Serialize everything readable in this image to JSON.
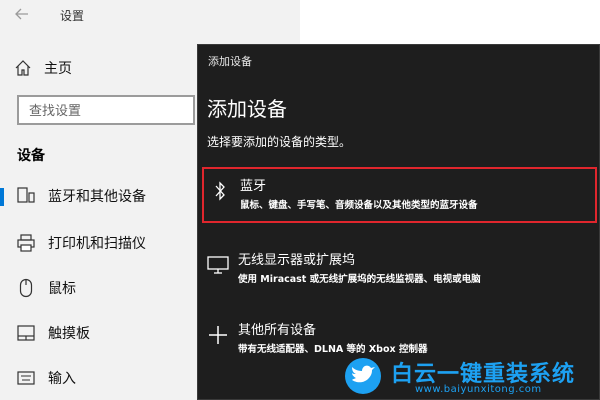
{
  "window": {
    "title": "设置"
  },
  "sidebar": {
    "home_label": "主页",
    "search_placeholder": "查找设置",
    "section_title": "设备",
    "items": [
      {
        "label": "蓝牙和其他设备",
        "icon": "bluetooth-devices-icon",
        "selected": true
      },
      {
        "label": "打印机和扫描仪",
        "icon": "printer-icon",
        "selected": false
      },
      {
        "label": "鼠标",
        "icon": "mouse-icon",
        "selected": false
      },
      {
        "label": "触摸板",
        "icon": "touchpad-icon",
        "selected": false
      },
      {
        "label": "输入",
        "icon": "keyboard-icon",
        "selected": false
      }
    ]
  },
  "dialog": {
    "caption": "添加设备",
    "heading": "添加设备",
    "subtitle": "选择要添加的设备的类型。",
    "options": [
      {
        "title": "蓝牙",
        "description": "鼠标、键盘、手写笔、音频设备以及其他类型的蓝牙设备",
        "icon": "bluetooth-icon",
        "highlighted": true
      },
      {
        "title": "无线显示器或扩展坞",
        "description": "使用 Miracast 或无线扩展坞的无线监视器、电视或电脑",
        "icon": "monitor-icon",
        "highlighted": false
      },
      {
        "title": "其他所有设备",
        "description": "带有无线适配器、DLNA 等的 Xbox 控制器",
        "icon": "plus-icon",
        "highlighted": false
      }
    ]
  },
  "watermark": {
    "brand": "白云一键重装系统",
    "url": "www.baiyunxitong.com"
  },
  "colors": {
    "accent": "#0078d7",
    "highlight_border": "#e0262d",
    "dialog_bg": "#1e1e1e",
    "sidebar_bg": "#f2f2f2",
    "watermark": "#1da1f2"
  }
}
